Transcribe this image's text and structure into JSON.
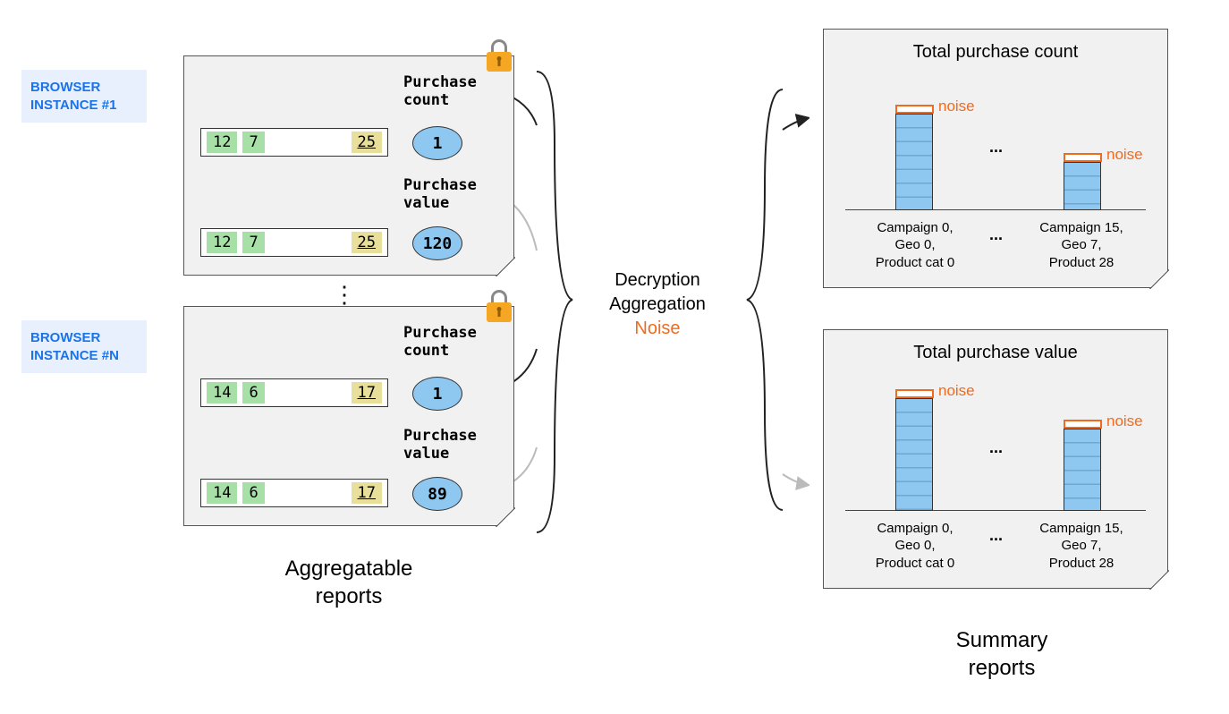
{
  "browsers": {
    "instance1": "BROWSER INSTANCE #1",
    "instanceN": "BROWSER INSTANCE #N"
  },
  "metrics": {
    "purchase_count_label": "Purchase\ncount",
    "purchase_value_label": "Purchase\nvalue"
  },
  "report1": {
    "k1": "12",
    "k2": "7",
    "k3": "25",
    "count": "1",
    "value": "120"
  },
  "reportN": {
    "k1": "14",
    "k2": "6",
    "k3": "17",
    "count": "1",
    "value": "89"
  },
  "center": {
    "line1": "Decryption",
    "line2": "Aggregation",
    "noise": "Noise"
  },
  "summary": {
    "count_title": "Total purchase count",
    "value_title": "Total purchase value",
    "noise": "noise",
    "cat0": "Campaign 0,\nGeo 0,\nProduct cat 0",
    "cat1": "Campaign 15,\nGeo 7,\nProduct 28",
    "dots": "..."
  },
  "sections": {
    "aggregatable": "Aggregatable\nreports",
    "summary": "Summary\nreports"
  },
  "chart_data": [
    {
      "type": "bar",
      "title": "Total purchase count",
      "categories": [
        "Campaign 0, Geo 0, Product cat 0",
        "...",
        "Campaign 15, Geo 7, Product 28"
      ],
      "values_relative": [
        100,
        null,
        50
      ],
      "noise": "added on top of each bar",
      "ylabel": "",
      "xlabel": ""
    },
    {
      "type": "bar",
      "title": "Total purchase value",
      "categories": [
        "Campaign 0, Geo 0, Product cat 0",
        "...",
        "Campaign 15, Geo 7, Product 28"
      ],
      "values_relative": [
        100,
        null,
        75
      ],
      "noise": "added on top of each bar",
      "ylabel": "",
      "xlabel": ""
    }
  ]
}
